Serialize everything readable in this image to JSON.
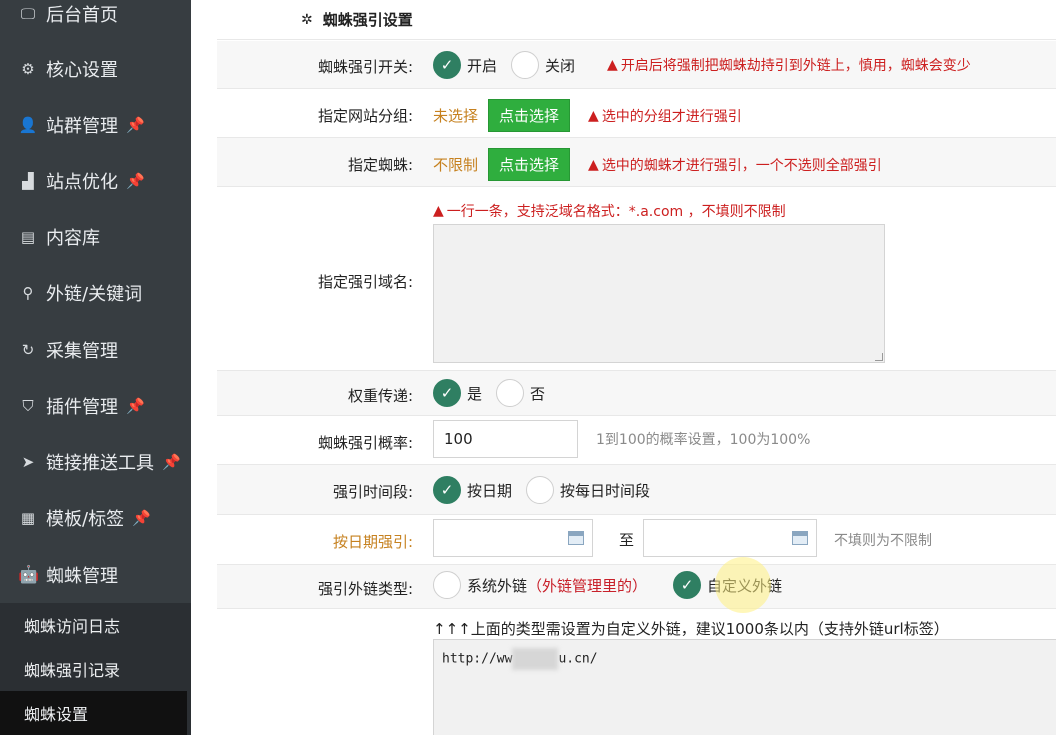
{
  "sidebar": {
    "items": [
      {
        "label": "后台首页",
        "icon": "monitor-icon",
        "glyph": "🖵",
        "pinned": false
      },
      {
        "label": "核心设置",
        "icon": "gear-icon",
        "glyph": "⚙",
        "pinned": false
      },
      {
        "label": "站群管理",
        "icon": "user-icon",
        "glyph": "👤",
        "pinned": true
      },
      {
        "label": "站点优化",
        "icon": "bar-chart-icon",
        "glyph": "▟",
        "pinned": true
      },
      {
        "label": "内容库",
        "icon": "document-icon",
        "glyph": "▤",
        "pinned": false
      },
      {
        "label": "外链/关键词",
        "icon": "key-icon",
        "glyph": "⚲",
        "pinned": false
      },
      {
        "label": "采集管理",
        "icon": "refresh-icon",
        "glyph": "↻",
        "pinned": false
      },
      {
        "label": "插件管理",
        "icon": "plugin-icon",
        "glyph": "⛉",
        "pinned": true
      },
      {
        "label": "链接推送工具",
        "icon": "send-icon",
        "glyph": "➤",
        "pinned": true
      },
      {
        "label": "模板/标签",
        "icon": "template-icon",
        "glyph": "▦",
        "pinned": true
      },
      {
        "label": "蜘蛛管理",
        "icon": "android-icon",
        "glyph": "🤖",
        "pinned": false
      }
    ],
    "sub_items": [
      {
        "label": "蜘蛛访问日志"
      },
      {
        "label": "蜘蛛强引记录"
      },
      {
        "label": "蜘蛛设置"
      }
    ],
    "pin_glyph": "📌",
    "accent_pin": "#f0a91d",
    "bg": "#373d41"
  },
  "panel": {
    "title": "蜘蛛强引设置",
    "title_icon": "gear-icon"
  },
  "form": {
    "switch": {
      "label": "蜘蛛强引开关:",
      "on_label": "开启",
      "off_label": "关闭",
      "selected": "on",
      "warning": "开启后将强制把蜘蛛劫持引到外链上，慎用，蜘蛛会变少"
    },
    "group": {
      "label": "指定网站分组:",
      "value": "未选择",
      "button": "点击选择",
      "warning": "选中的分组才进行强引"
    },
    "spider": {
      "label": "指定蜘蛛:",
      "value": "不限制",
      "button": "点击选择",
      "warning": "选中的蜘蛛才进行强引，一个不选则全部强引"
    },
    "domain": {
      "label": "指定强引域名:",
      "hint": "一行一条，支持泛域名格式：*.a.com ，不填则不限制",
      "value": ""
    },
    "weight": {
      "label": "权重传递:",
      "yes_label": "是",
      "no_label": "否",
      "selected": "yes"
    },
    "rate": {
      "label": "蜘蛛强引概率:",
      "value": "100",
      "hint": "1到100的概率设置，100为100%"
    },
    "time": {
      "label": "强引时间段:",
      "opt_date": "按日期",
      "opt_daily": "按每日时间段",
      "selected": "date"
    },
    "date_range": {
      "label": "按日期强引:",
      "start": "",
      "sep": "至",
      "end": "",
      "hint": "不填则为不限制"
    },
    "link_type": {
      "label": "强引外链类型:",
      "opt_system": "系统外链",
      "opt_system_note": "（外链管理里的）",
      "opt_custom": "自定义外链",
      "selected": "custom"
    },
    "custom_links": {
      "hint": "↑↑↑上面的类型需设置为自定义外链，建议1000条以内（支持外链url标签）",
      "line_prefix": "http://ww",
      "line_suffix": "u.cn/"
    }
  },
  "colors": {
    "radio_on": "#2f7f62",
    "button_green": "#2fae3e",
    "warning_red": "#cc1f1f",
    "label_orange": "#c6811f"
  }
}
